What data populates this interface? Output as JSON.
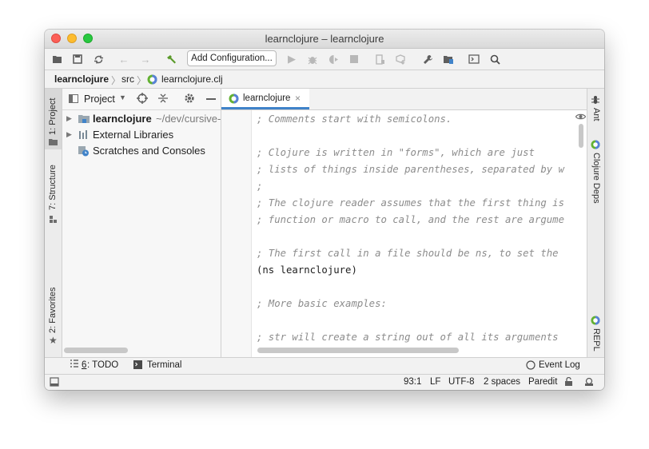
{
  "window": {
    "title": "learnclojure – learnclojure"
  },
  "toolbar": {
    "add_configuration": "Add Configuration..."
  },
  "breadcrumb": {
    "project": "learnclojure",
    "folder": "src",
    "file": "learnclojure.clj"
  },
  "left_tabs": {
    "project": "1: Project",
    "structure": "7: Structure",
    "favorites": "2: Favorites"
  },
  "right_tabs": {
    "ant": "Ant",
    "clojure_deps": "Clojure Deps",
    "repl": "REPL"
  },
  "project_panel": {
    "view_selector": "Project",
    "tree": [
      {
        "name": "learnclojure",
        "path": "~/dev/cursive-",
        "bold": true
      },
      {
        "name": "External Libraries"
      },
      {
        "name": "Scratches and Consoles"
      }
    ]
  },
  "editor": {
    "tab_label": "learnclojure",
    "lines": [
      {
        "text": "; Comments start with semicolons.",
        "kind": "comment"
      },
      {
        "text": "",
        "kind": "blank"
      },
      {
        "text": "; Clojure is written in \"forms\", which are just",
        "kind": "comment"
      },
      {
        "text": "; lists of things inside parentheses, separated by w",
        "kind": "comment"
      },
      {
        "text": ";",
        "kind": "comment"
      },
      {
        "text": "; The clojure reader assumes that the first thing is",
        "kind": "comment"
      },
      {
        "text": "; function or macro to call, and the rest are argume",
        "kind": "comment"
      },
      {
        "text": "",
        "kind": "blank"
      },
      {
        "text": "; The first call in a file should be ns, to set the",
        "kind": "comment"
      },
      {
        "text": "(ns learnclojure)",
        "kind": "code"
      },
      {
        "text": "",
        "kind": "blank"
      },
      {
        "text": "; More basic examples:",
        "kind": "comment"
      },
      {
        "text": "",
        "kind": "blank"
      },
      {
        "text": "; str will create a string out of all its arguments",
        "kind": "comment"
      }
    ]
  },
  "bottom_tabs": {
    "todo_num": "6",
    "todo_rest": ": TODO",
    "terminal": "Terminal",
    "event_log": "Event Log"
  },
  "status": {
    "position": "93:1",
    "line_sep": "LF",
    "encoding": "UTF-8",
    "indent": "2 spaces",
    "mode": "Paredit"
  },
  "colors": {
    "tab_underline": "#4083c9",
    "build_icon": "#5a9a2a",
    "clojure_green": "#63b132",
    "clojure_blue": "#5881d8"
  }
}
